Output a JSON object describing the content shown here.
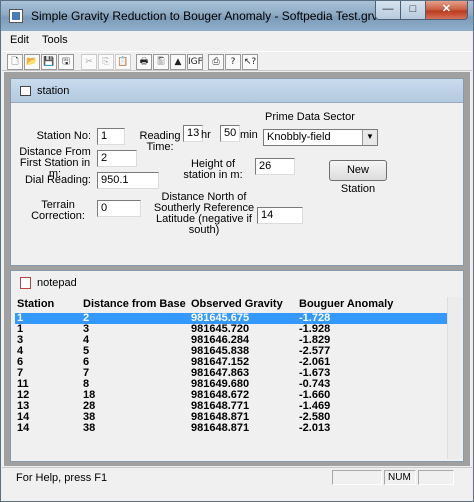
{
  "window": {
    "title": "Simple Gravity Reduction to Bouger Anomaly - Softpedia Test.grv",
    "min": "—",
    "max": "□",
    "close": "✕"
  },
  "menu": {
    "edit": "Edit",
    "tools": "Tools"
  },
  "toolbar": {
    "icons": [
      "new-icon",
      "open-icon",
      "save-icon",
      "save-as-icon",
      "cut-icon",
      "copy-icon",
      "paste-icon",
      "print-icon",
      "print-preview-icon",
      "chart-icon",
      "igf-icon",
      "print-setup-icon",
      "help-icon",
      "context-help-icon"
    ],
    "glyphs": [
      "🗋",
      "📂",
      "💾",
      "🖫",
      "✂",
      "⎘",
      "📋",
      "🖶",
      "🖺",
      "▲",
      "IGF",
      "⎙",
      "?",
      "↖?"
    ]
  },
  "station_window": {
    "title": "station",
    "station_no_label": "Station No:",
    "station_no_value": "1",
    "distance_label": "Distance From First Station in m:",
    "distance_value": "2",
    "dial_label": "Dial Reading:",
    "dial_value": "950.1",
    "terrain_label": "Terrain Correction:",
    "terrain_value": "0",
    "reading_time_label": "Reading Time:",
    "hour_value": "13",
    "hr_unit": "hr",
    "min_value": "50",
    "min_unit": "min",
    "height_label": "Height of station in m:",
    "height_value": "26",
    "north_label": "Distance North of Southerly Reference Latitude (negative if south)",
    "north_value": "14",
    "datum_label": "Prime Data Sector",
    "datum_value": "Knobbly-field",
    "new_station_button": "New Station"
  },
  "notepad_window": {
    "title": "notepad",
    "columns": [
      "Station",
      "Distance from Base",
      "Observed Gravity",
      "Bouguer Anomaly"
    ],
    "rows": [
      [
        "1",
        "2",
        "981645.675",
        "-1.728"
      ],
      [
        "1",
        "3",
        "981645.720",
        "-1.928"
      ],
      [
        "3",
        "4",
        "981646.284",
        "-1.829"
      ],
      [
        "4",
        "5",
        "981645.838",
        "-2.577"
      ],
      [
        "6",
        "6",
        "981647.152",
        "-2.061"
      ],
      [
        "7",
        "7",
        "981647.863",
        "-1.673"
      ],
      [
        "11",
        "8",
        "981649.680",
        "-0.743"
      ],
      [
        "12",
        "18",
        "981648.672",
        "-1.660"
      ],
      [
        "13",
        "28",
        "981648.771",
        "-1.469"
      ],
      [
        "14",
        "38",
        "981648.871",
        "-2.580"
      ],
      [
        "14",
        "38",
        "981648.871",
        "-2.013"
      ]
    ]
  },
  "status": {
    "help_text": "For Help, press F1",
    "num": "NUM"
  }
}
